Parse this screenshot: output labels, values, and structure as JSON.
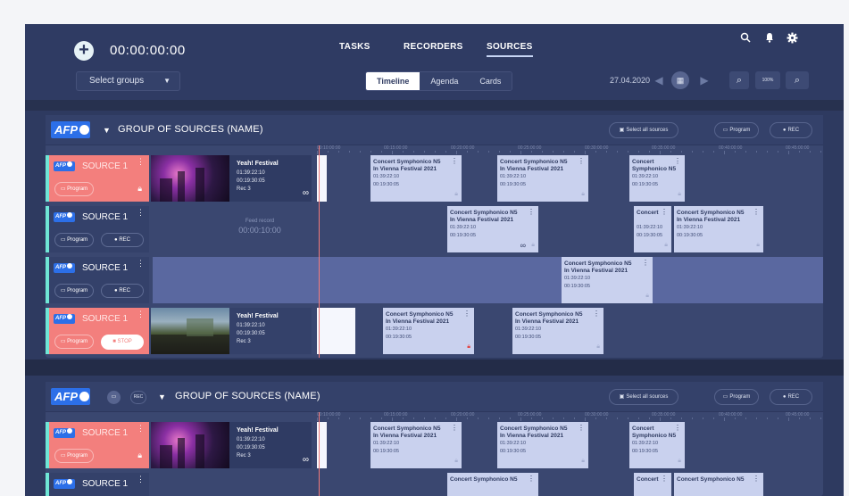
{
  "header": {
    "clock": "00:00:00:00",
    "tabs": [
      "TASKS",
      "RECORDERS",
      "SOURCES"
    ],
    "active_tab": "SOURCES",
    "select_groups": "Select groups",
    "views": [
      "Timeline",
      "Agenda",
      "Cards"
    ],
    "active_view": "Timeline",
    "date": "27.04.2020",
    "zoom_level": "100%"
  },
  "ruler_ticks": [
    "00:10:00:00",
    "00:15:00:00",
    "00:20:00:00",
    "00:25:00:00",
    "00:30:00:00",
    "00:35:00:00",
    "00:40:00:00",
    "00:45:00:00"
  ],
  "groups": [
    {
      "logo": "AFP",
      "title": "GROUP OF SOURCES (NAME)",
      "select_all": "Select all sources",
      "program": "Program",
      "rec": "REC"
    },
    {
      "logo": "AFP",
      "title": "GROUP OF SOURCES (NAME)",
      "select_all": "Select all sources",
      "program": "Program",
      "rec": "REC",
      "mini_rec": "REC"
    }
  ],
  "sources": {
    "name": "SOURCE 1",
    "logo": "AFP",
    "program": "Program",
    "rec": "REC",
    "stop": "STOP"
  },
  "live": {
    "title": "Yeah! Festival",
    "t1": "01:39:22:10",
    "t2": "00:19:30:05",
    "rec": "Rec 3"
  },
  "recording": {
    "title1": "Concert Symphonico N5",
    "title2": "In Vienna Festival 2021",
    "short1": "Concert",
    "short2": "Symphonico N5",
    "t1": "01:39:22:10",
    "t2": "00:19:30:05"
  },
  "feed": {
    "label": "Feed record",
    "time": "00:00:10:00"
  }
}
